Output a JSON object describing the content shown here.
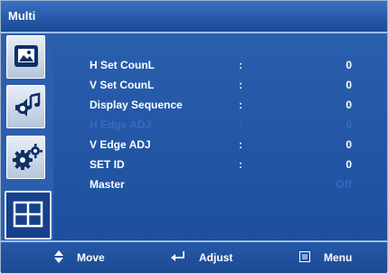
{
  "window": {
    "title": "Multi"
  },
  "sidebar": {
    "tabs": [
      {
        "icon": "picture-icon",
        "active": false
      },
      {
        "icon": "sound-icon",
        "active": false
      },
      {
        "icon": "gear-icon",
        "active": false
      },
      {
        "icon": "multi-grid-icon",
        "active": true
      }
    ]
  },
  "menu": {
    "rows": [
      {
        "label": "H Set CounL",
        "colon": ":",
        "value": "0"
      },
      {
        "label": "V Set CounL",
        "colon": ":",
        "value": "0"
      },
      {
        "label": "Display Sequence",
        "colon": ":",
        "value": "0"
      },
      {
        "label": "H Edge ADJ",
        "colon": ":",
        "value": "0"
      },
      {
        "label": "V Edge ADJ",
        "colon": ":",
        "value": "0"
      },
      {
        "label": "SET ID",
        "colon": ":",
        "value": "0"
      },
      {
        "label": "Master",
        "colon": "",
        "value": "Off"
      }
    ]
  },
  "footer": {
    "move_label": "Move",
    "adjust_label": "Adjust",
    "menu_label": "Menu"
  }
}
